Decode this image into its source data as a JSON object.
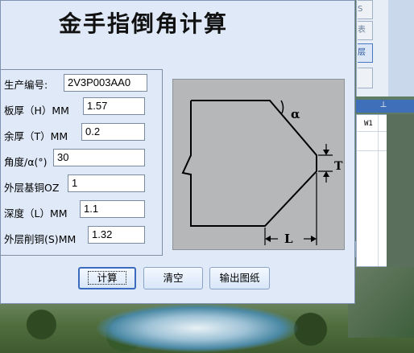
{
  "dialog": {
    "title": "金手指倒角计算",
    "fields": [
      {
        "label": "生产编号:",
        "value": "2V3P003AA0"
      },
      {
        "label": "板厚（H）MM",
        "value": "1.57"
      },
      {
        "label": "余厚（T）MM",
        "value": "0.2"
      },
      {
        "label": "角度/α(°)",
        "value": "30"
      },
      {
        "label": "外层基铜OZ",
        "value": "1"
      },
      {
        "label": "深度（L）MM",
        "value": "1.1"
      },
      {
        "label": "外层削铜(S)MM",
        "value": "1.32"
      }
    ],
    "buttons": {
      "calculate": "计算",
      "clear": "清空",
      "export": "输出图纸"
    },
    "diagram_labels": {
      "alpha": "α",
      "t": "T",
      "l": "L"
    }
  },
  "background_app": {
    "side_buttons": [
      "S",
      "表",
      "层"
    ],
    "grid_header": "W1",
    "pin_glyph": "⊥"
  },
  "colors": {
    "dialog_bg": "#dfe9f7",
    "accent": "#3a6bbf",
    "diagram_bg": "#b6b7b9"
  }
}
